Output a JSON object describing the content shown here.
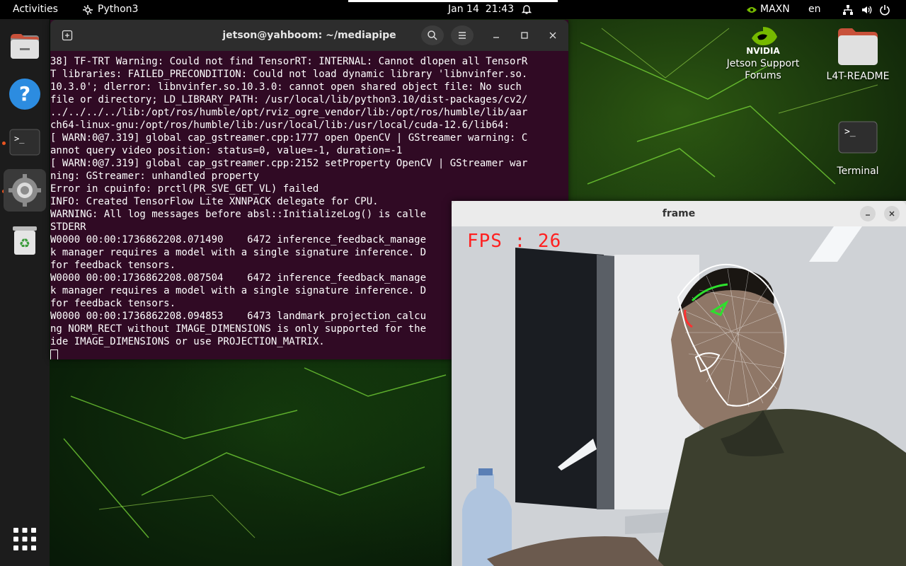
{
  "topbar": {
    "activities": "Activities",
    "app_menu": "Python3",
    "clock": "Jan 14  21:43",
    "power_mode": "MAXN",
    "language": "en"
  },
  "terminal": {
    "title": "jetson@yahboom: ~/mediapipe",
    "lines": [
      "38] TF-TRT Warning: Could not find TensorRT: INTERNAL: Cannot dlopen all TensorR",
      "T libraries: FAILED_PRECONDITION: Could not load dynamic library 'libnvinfer.so.",
      "10.3.0'; dlerror: libnvinfer.so.10.3.0: cannot open shared object file: No such",
      "file or directory; LD_LIBRARY_PATH: /usr/local/lib/python3.10/dist-packages/cv2/",
      "../../../../lib:/opt/ros/humble/opt/rviz_ogre_vendor/lib:/opt/ros/humble/lib/aar",
      "ch64-linux-gnu:/opt/ros/humble/lib:/usr/local/lib:/usr/local/cuda-12.6/lib64:",
      "[ WARN:0@7.319] global cap_gstreamer.cpp:1777 open OpenCV | GStreamer warning: C",
      "annot query video position: status=0, value=-1, duration=-1",
      "[ WARN:0@7.319] global cap_gstreamer.cpp:2152 setProperty OpenCV | GStreamer war",
      "ning: GStreamer: unhandled property",
      "Error in cpuinfo: prctl(PR_SVE_GET_VL) failed",
      "INFO: Created TensorFlow Lite XNNPACK delegate for CPU.",
      "WARNING: All log messages before absl::InitializeLog() is calle",
      "STDERR",
      "W0000 00:00:1736862208.071490    6472 inference_feedback_manage",
      "k manager requires a model with a single signature inference. D",
      "for feedback tensors.",
      "W0000 00:00:1736862208.087504    6472 inference_feedback_manage",
      "k manager requires a model with a single signature inference. D",
      "for feedback tensors.",
      "W0000 00:00:1736862208.094853    6473 landmark_projection_calcu",
      "ng NORM_RECT without IMAGE_DIMENSIONS is only supported for the",
      "ide IMAGE_DIMENSIONS or use PROJECTION_MATRIX."
    ]
  },
  "desktop": {
    "nvidia_logo_text": "NVIDIA",
    "icons": [
      {
        "label_line1": "Jetson Support",
        "label_line2": "Forums"
      },
      {
        "label_line1": "L4T-README",
        "label_line2": ""
      },
      {
        "label_line1": "Terminal",
        "label_line2": ""
      }
    ]
  },
  "frame": {
    "title": "frame",
    "fps_text": "FPS : 26"
  },
  "dock": {
    "items": [
      "files-icon",
      "help-icon",
      "terminal-icon",
      "settings-icon",
      "trash-icon",
      "app-grid-icon"
    ]
  }
}
